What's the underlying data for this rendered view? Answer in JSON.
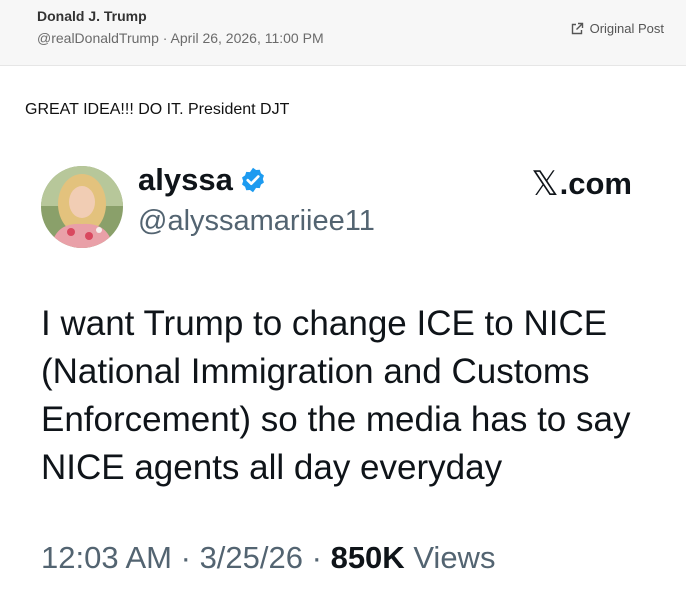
{
  "post": {
    "author_name": "Donald J. Trump",
    "author_handle": "@realDonaldTrump",
    "separator": "·",
    "timestamp": "April 26, 2026, 11:00 PM",
    "original_post_label": "Original Post",
    "text": "GREAT IDEA!!! DO IT. President DJT"
  },
  "tweet": {
    "name": "alyssa",
    "handle": "@alyssamariiee11",
    "brand_suffix": ".com",
    "body": "I want Trump to change ICE to NICE (National Immigration and Customs Enforcement) so the media has to say NICE agents all day everyday",
    "time": "12:03 AM",
    "date": "3/25/26",
    "views_count": "850K",
    "views_label": "Views",
    "separator": "·",
    "verified_color": "#1d9bf0"
  },
  "icons": {
    "external_link": "external-link-icon",
    "verified": "verified-badge-icon",
    "x_logo": "x-logo-icon"
  }
}
